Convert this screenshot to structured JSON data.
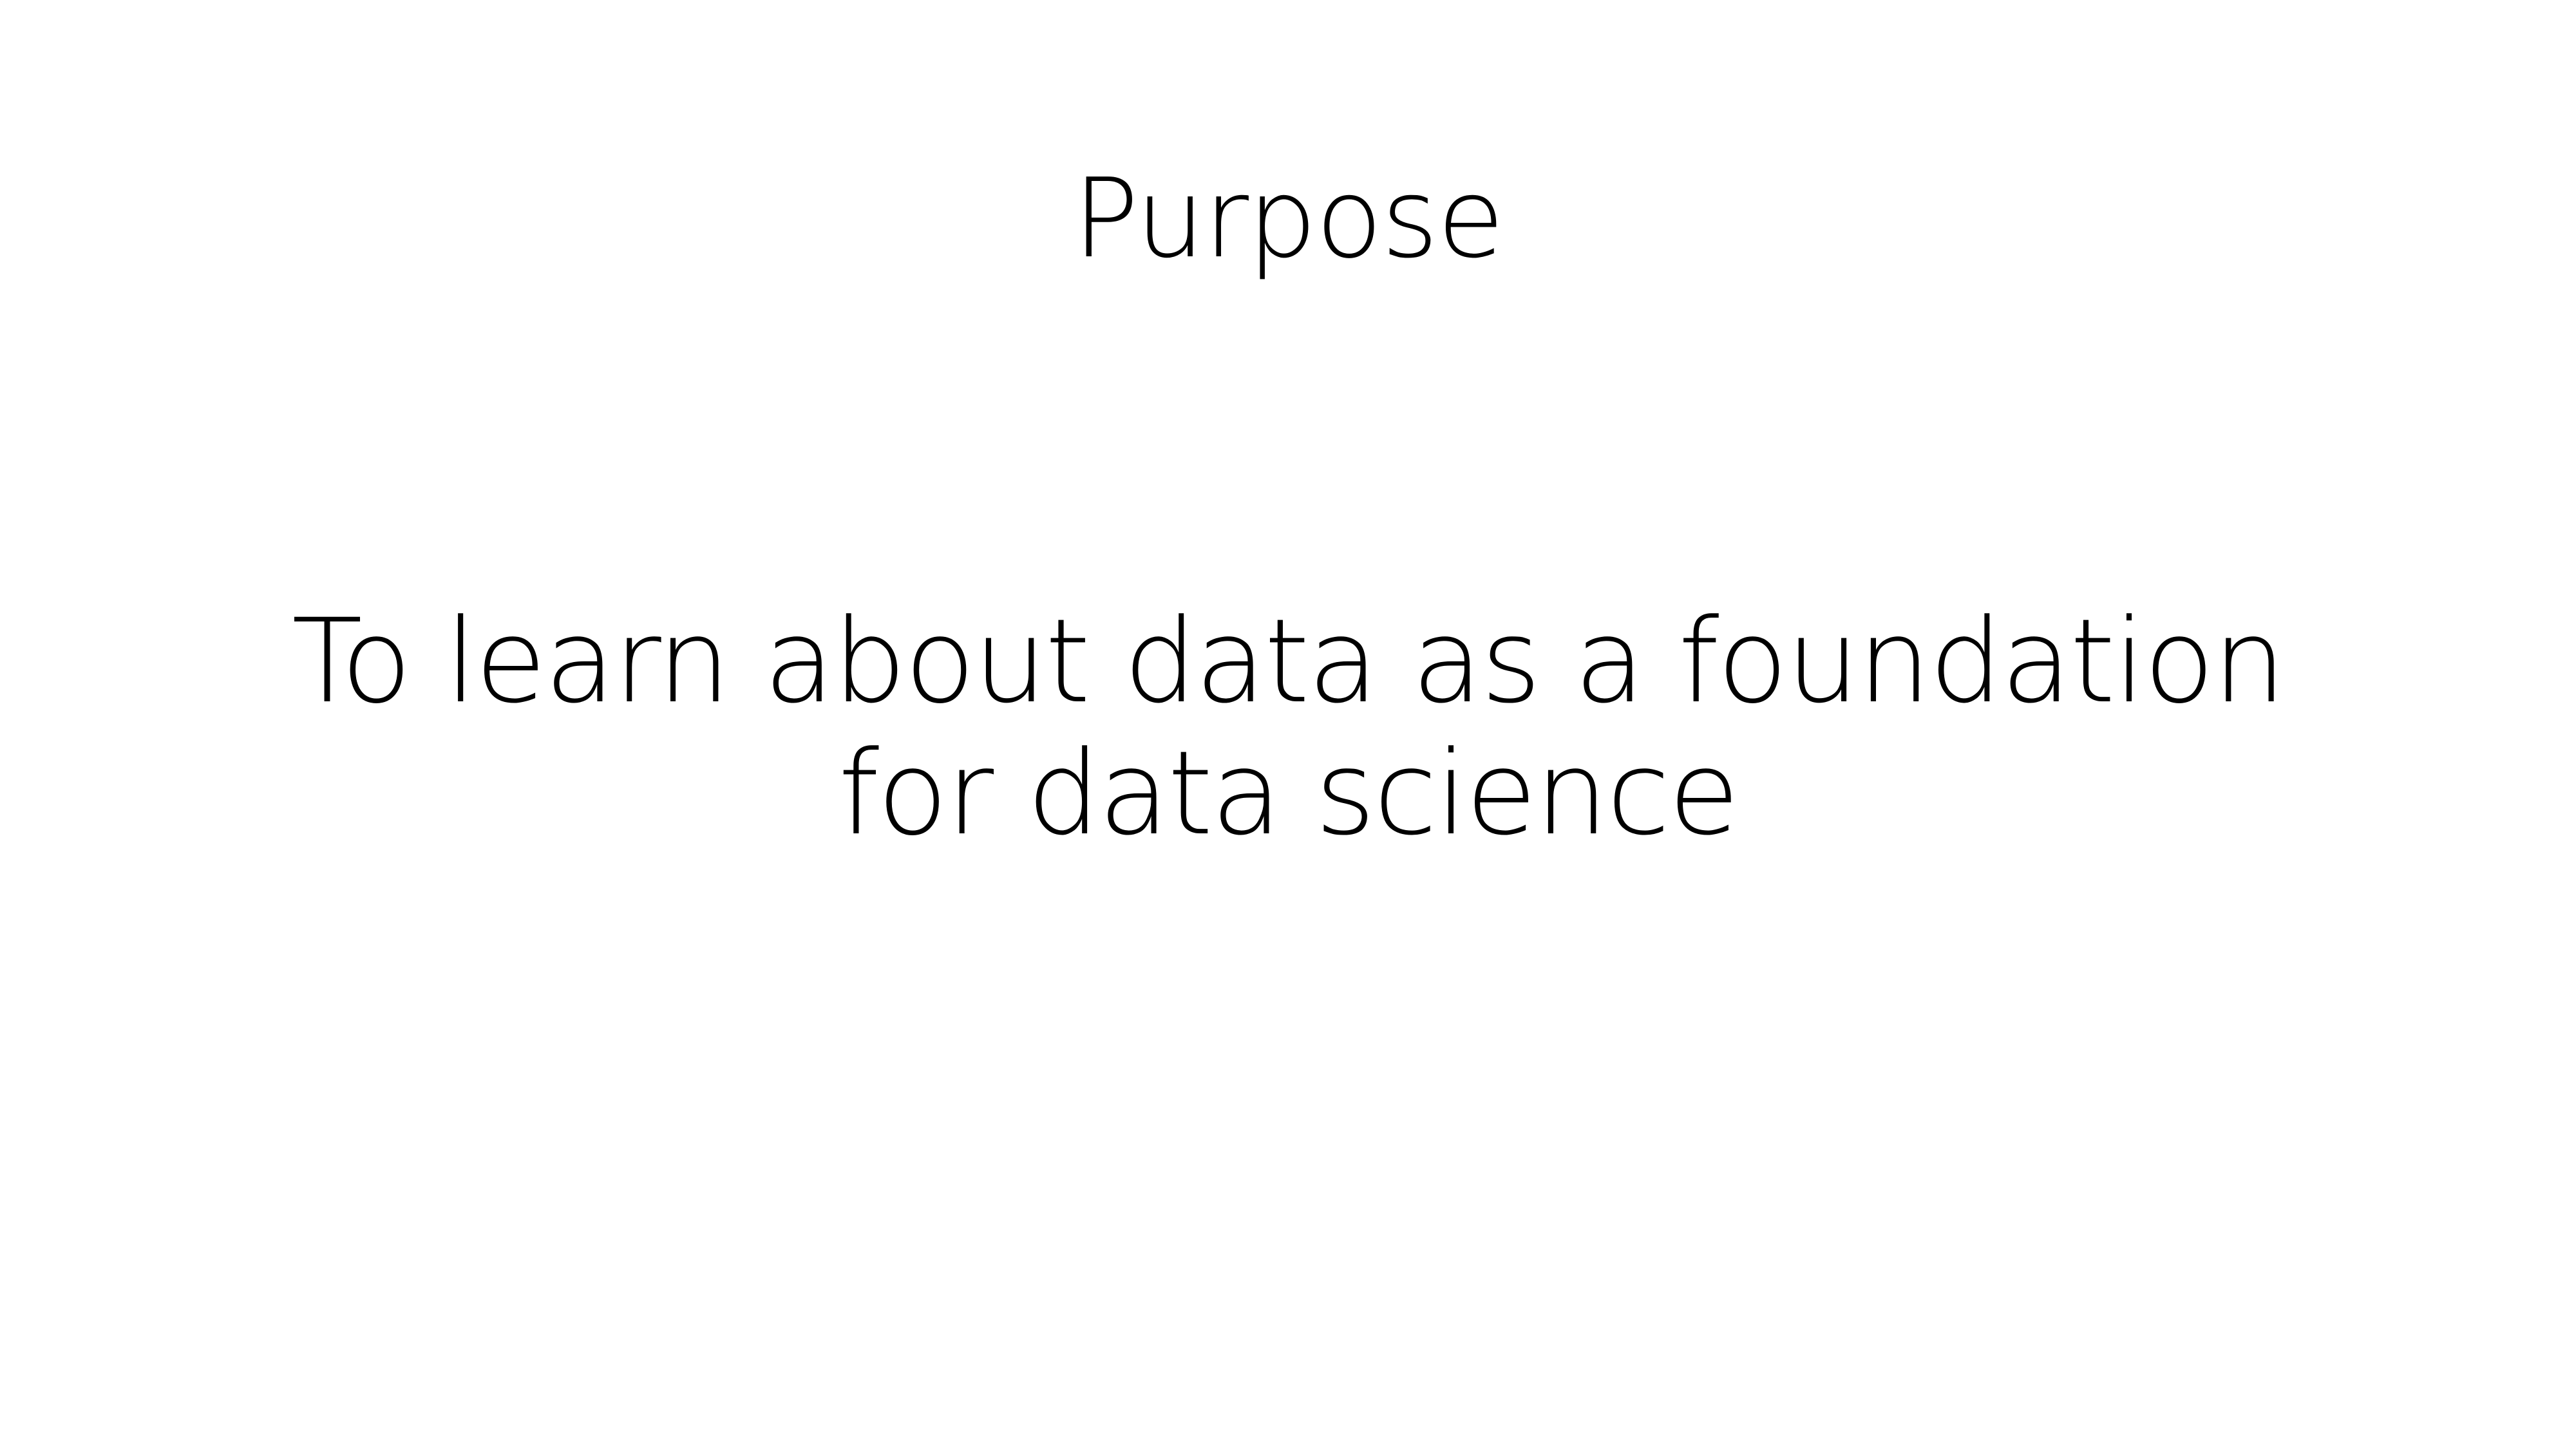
{
  "slide": {
    "title": "Purpose",
    "body_lines": [
      "To learn about data as a foundation",
      "for data science"
    ]
  },
  "colors": {
    "background": "#ffffff",
    "text": "#000000"
  }
}
